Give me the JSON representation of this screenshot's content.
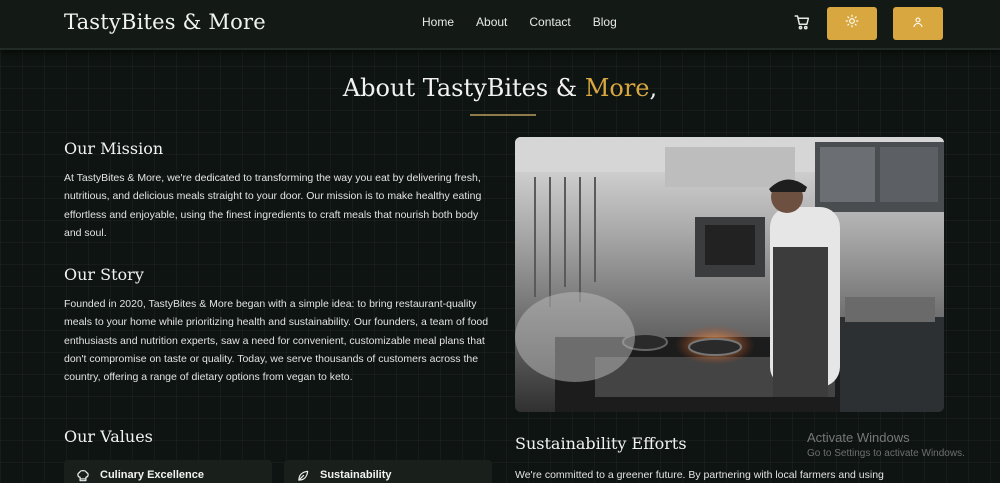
{
  "brand": {
    "name": "TastyBites & More"
  },
  "nav": {
    "links": [
      "Home",
      "About",
      "Contact",
      "Blog"
    ]
  },
  "colors": {
    "accent": "#d9a740",
    "background": "#0e1411"
  },
  "icons": {
    "cart": "cart-icon",
    "theme": "sun-icon",
    "user": "user-icon"
  },
  "hero": {
    "title_prefix": "About TastyBites ",
    "title_amp": "&",
    "title_accent": "More",
    "title_suffix": ","
  },
  "mission": {
    "heading": "Our Mission",
    "text": "At TastyBites & More, we're dedicated to transforming the way you eat by delivering fresh, nutritious, and delicious meals straight to your door. Our mission is to make healthy eating effortless and enjoyable, using the finest ingredients to craft meals that nourish both body and soul."
  },
  "story": {
    "heading": "Our Story",
    "text": "Founded in 2020, TastyBites & More began with a simple idea: to bring restaurant-quality meals to your home while prioritizing health and sustainability. Our founders, a team of food enthusiasts and nutrition experts, saw a need for convenient, customizable meal plans that don't compromise on taste or quality. Today, we serve thousands of customers across the country, offering a range of dietary options from vegan to keto."
  },
  "values": {
    "heading": "Our Values",
    "items": [
      {
        "label": "Culinary Excellence",
        "icon": "chef-hat-icon"
      },
      {
        "label": "Sustainability",
        "icon": "leaf-icon"
      }
    ]
  },
  "sustainability": {
    "heading": "Sustainability Efforts",
    "text": "We're committed to a greener future. By partnering with local farmers and using"
  },
  "watermark": {
    "title": "Activate Windows",
    "subtitle": "Go to Settings to activate Windows."
  }
}
